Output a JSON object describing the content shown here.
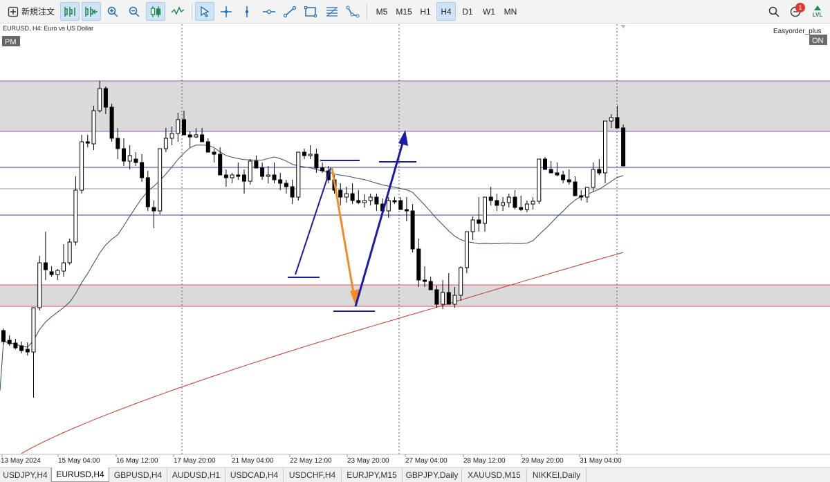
{
  "toolbar": {
    "new_order_label": "新規注文",
    "tools": [
      {
        "name": "depth-of-market-icon"
      },
      {
        "name": "one-click-trading-icon"
      },
      {
        "name": "zoom-in-icon"
      },
      {
        "name": "zoom-out-icon"
      },
      {
        "name": "candlestick-chart-icon"
      },
      {
        "name": "indicator-icon"
      },
      {
        "name": "cursor-icon"
      },
      {
        "name": "crosshair-icon"
      },
      {
        "name": "vertical-line-icon"
      },
      {
        "name": "horizontal-line-icon"
      },
      {
        "name": "trend-line-icon"
      },
      {
        "name": "rectangle-icon"
      },
      {
        "name": "fibonacci-icon"
      },
      {
        "name": "shapes-icon"
      }
    ],
    "timeframes": [
      "M5",
      "M15",
      "H1",
      "H4",
      "D1",
      "W1",
      "MN"
    ],
    "active_timeframe": "H4",
    "notification_count": "1",
    "lvl_label": "LVL"
  },
  "chart_data": {
    "type": "candlestick",
    "symbol_label": "EURUSD, H4:  Euro vs US Dollar",
    "pm_label": "PM",
    "ea_label": "Easyorder_plus",
    "ea_status": "ON",
    "x_ticks": [
      "13 May 2024",
      "15 May 04:00",
      "16 May 12:00",
      "17 May 20:00",
      "21 May 04:00",
      "22 May 12:00",
      "23 May 20:00",
      "27 May 04:00",
      "28 May 12:00",
      "29 May 20:00",
      "31 May 04:00"
    ],
    "y_range": [
      0,
      640
    ],
    "candles": [
      [
        0,
        443,
        463,
        440,
        459
      ],
      [
        1,
        457,
        465,
        450,
        462
      ],
      [
        2,
        461,
        470,
        455,
        468
      ],
      [
        3,
        465,
        476,
        459,
        472
      ],
      [
        4,
        470,
        479,
        460,
        474
      ],
      [
        5,
        474,
        540,
        410,
        410
      ],
      [
        6,
        410,
        414,
        335,
        345
      ],
      [
        7,
        345,
        370,
        300,
        355
      ],
      [
        8,
        358,
        365,
        350,
        362
      ],
      [
        9,
        362,
        370,
        354,
        356
      ],
      [
        10,
        357,
        365,
        318,
        345
      ],
      [
        11,
        345,
        348,
        310,
        315
      ],
      [
        12,
        315,
        320,
        220,
        240
      ],
      [
        13,
        240,
        245,
        160,
        170
      ],
      [
        14,
        170,
        178,
        160,
        172
      ],
      [
        15,
        173,
        182,
        118,
        125
      ],
      [
        16,
        125,
        128,
        82,
        93
      ],
      [
        17,
        93,
        130,
        90,
        120
      ],
      [
        18,
        120,
        170,
        115,
        165
      ],
      [
        19,
        165,
        195,
        150,
        180
      ],
      [
        20,
        180,
        205,
        165,
        198
      ],
      [
        21,
        198,
        210,
        175,
        190
      ],
      [
        22,
        195,
        205,
        185,
        200
      ],
      [
        23,
        200,
        228,
        188,
        222
      ],
      [
        24,
        222,
        270,
        212,
        264
      ],
      [
        25,
        265,
        295,
        255,
        270
      ],
      [
        26,
        270,
        275,
        180,
        180
      ],
      [
        27,
        180,
        185,
        150,
        165
      ],
      [
        28,
        165,
        175,
        148,
        158
      ],
      [
        29,
        158,
        170,
        128,
        138
      ],
      [
        30,
        138,
        150,
        125,
        160
      ],
      [
        31,
        160,
        178,
        155,
        163
      ],
      [
        32,
        163,
        165,
        150,
        160
      ],
      [
        33,
        160,
        170,
        150,
        170
      ],
      [
        34,
        170,
        185,
        165,
        185
      ],
      [
        35,
        185,
        200,
        180,
        188
      ],
      [
        36,
        188,
        200,
        178,
        218
      ],
      [
        37,
        218,
        235,
        210,
        222
      ],
      [
        38,
        222,
        230,
        215,
        218
      ],
      [
        39,
        218,
        225,
        200,
        218
      ],
      [
        40,
        218,
        245,
        210,
        227
      ],
      [
        41,
        227,
        232,
        195,
        198
      ],
      [
        42,
        198,
        205,
        190,
        208
      ],
      [
        43,
        208,
        225,
        200,
        220
      ],
      [
        44,
        220,
        230,
        205,
        218
      ],
      [
        45,
        218,
        230,
        200,
        225
      ],
      [
        46,
        225,
        240,
        215,
        230
      ],
      [
        47,
        230,
        245,
        225,
        235
      ],
      [
        48,
        235,
        260,
        225,
        250
      ],
      [
        49,
        250,
        255,
        185,
        185
      ],
      [
        50,
        185,
        195,
        180,
        190
      ],
      [
        51,
        190,
        195,
        175,
        188
      ],
      [
        52,
        188,
        215,
        180,
        208
      ],
      [
        53,
        208,
        215,
        200,
        212
      ],
      [
        54,
        212,
        230,
        205,
        225
      ],
      [
        55,
        225,
        245,
        218,
        240
      ],
      [
        56,
        240,
        262,
        230,
        250
      ],
      [
        57,
        250,
        258,
        235,
        245
      ],
      [
        58,
        245,
        260,
        230,
        255
      ],
      [
        59,
        255,
        260,
        240,
        258
      ],
      [
        60,
        258,
        265,
        246,
        255
      ],
      [
        61,
        255,
        262,
        245,
        250
      ],
      [
        62,
        250,
        270,
        245,
        260
      ],
      [
        63,
        260,
        275,
        252,
        270
      ],
      [
        64,
        270,
        280,
        250,
        255
      ],
      [
        65,
        255,
        260,
        250,
        255
      ],
      [
        66,
        255,
        265,
        250,
        268
      ],
      [
        67,
        268,
        285,
        250,
        270
      ],
      [
        68,
        270,
        330,
        260,
        325
      ],
      [
        69,
        325,
        380,
        310,
        370
      ],
      [
        70,
        370,
        380,
        350,
        372
      ],
      [
        71,
        372,
        384,
        365,
        384
      ],
      [
        72,
        384,
        410,
        378,
        405
      ],
      [
        73,
        405,
        412,
        370,
        388
      ],
      [
        74,
        388,
        404,
        360,
        405
      ],
      [
        75,
        405,
        410,
        380,
        392
      ],
      [
        76,
        392,
        400,
        350,
        352
      ],
      [
        77,
        352,
        360,
        300,
        300
      ],
      [
        78,
        300,
        312,
        278,
        283
      ],
      [
        79,
        283,
        300,
        250,
        288
      ],
      [
        80,
        288,
        300,
        250,
        250
      ],
      [
        81,
        250,
        262,
        235,
        255
      ],
      [
        82,
        255,
        270,
        245,
        262
      ],
      [
        83,
        262,
        270,
        250,
        258
      ],
      [
        84,
        258,
        265,
        245,
        250
      ],
      [
        85,
        250,
        268,
        240,
        265
      ],
      [
        86,
        265,
        270,
        248,
        268
      ],
      [
        87,
        268,
        272,
        255,
        260
      ],
      [
        88,
        260,
        268,
        250,
        256
      ],
      [
        89,
        256,
        260,
        195,
        195
      ],
      [
        90,
        195,
        200,
        192,
        210
      ],
      [
        91,
        210,
        215,
        198,
        215
      ],
      [
        92,
        215,
        220,
        200,
        218
      ],
      [
        93,
        218,
        230,
        212,
        225
      ],
      [
        94,
        225,
        232,
        210,
        228
      ],
      [
        95,
        228,
        242,
        220,
        248
      ],
      [
        96,
        248,
        255,
        240,
        250
      ],
      [
        97,
        250,
        258,
        238,
        236
      ],
      [
        98,
        236,
        242,
        200,
        210
      ],
      [
        99,
        210,
        218,
        195,
        215
      ],
      [
        100,
        215,
        230,
        140,
        140
      ],
      [
        101,
        140,
        150,
        130,
        135
      ],
      [
        102,
        135,
        150,
        118,
        150
      ],
      [
        103,
        150,
        205,
        145,
        205
      ]
    ],
    "resistance_zone": [
      82,
      155
    ],
    "support_zone": [
      377,
      408
    ],
    "hlines": [
      207,
      238,
      276
    ]
  },
  "tabs": [
    {
      "label": "USDJPY,H4",
      "active": false
    },
    {
      "label": "EURUSD,H4",
      "active": true
    },
    {
      "label": "GBPUSD,H4",
      "active": false
    },
    {
      "label": "AUDUSD,H1",
      "active": false
    },
    {
      "label": "USDCAD,H4",
      "active": false
    },
    {
      "label": "USDCHF,H4",
      "active": false
    },
    {
      "label": "EURJPY,M15",
      "active": false
    },
    {
      "label": "GBPJPY,Daily",
      "active": false
    },
    {
      "label": "XAUUSD,M15",
      "active": false
    },
    {
      "label": "NIKKEI,Daily",
      "active": false
    }
  ],
  "colors": {
    "zone_fill": "#dadada",
    "resistance_border": "#9b59b6",
    "support_border": "#d9534f",
    "pattern_blue": "#1a1aa6",
    "arrow_orange": "#f28c28",
    "ma_short": "#34495e",
    "ma_long": "#c0392b"
  }
}
